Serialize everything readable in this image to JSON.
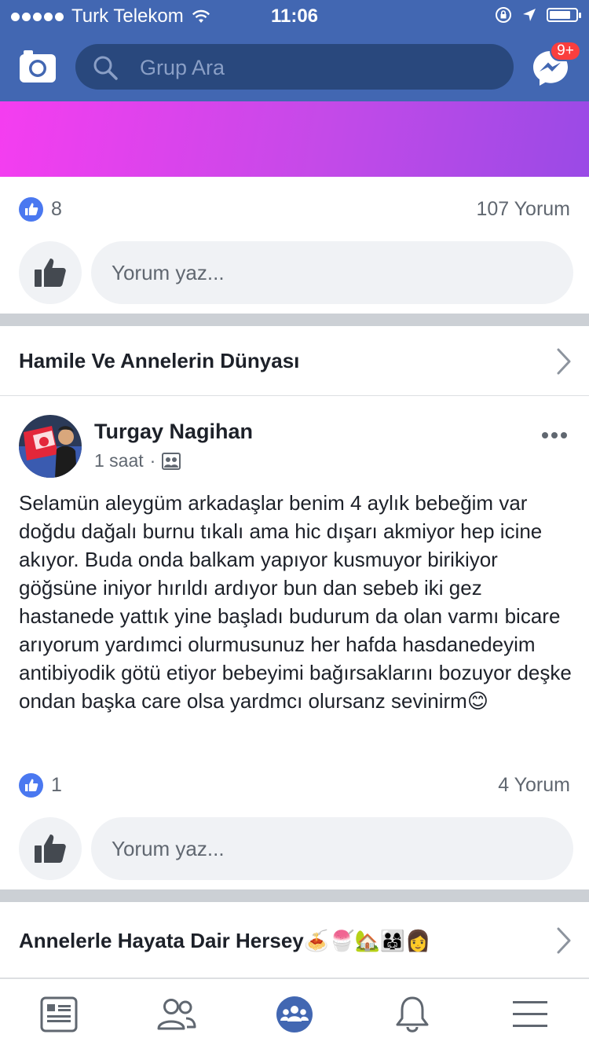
{
  "status_bar": {
    "carrier": "Turk Telekom",
    "time": "11:06",
    "battery_level": 0.8
  },
  "header": {
    "search_placeholder": "Grup Ara",
    "messenger_badge": "9+",
    "icons": {
      "camera": "camera-icon",
      "search": "search-icon",
      "messenger": "messenger-icon"
    }
  },
  "colors": {
    "brand": "#4267b2",
    "search_bg": "#29487d",
    "banner_start": "#f53df0",
    "banner_end": "#9a4ae6",
    "like": "#4a78f0",
    "badge": "#fa3e3e",
    "separator": "#ccd0d5"
  },
  "post1": {
    "like_count": "8",
    "comment_count": "107 Yorum",
    "comment_placeholder": "Yorum yaz..."
  },
  "group1": {
    "title": "Hamile Ve Annelerin Dünyası"
  },
  "post2": {
    "author": "Turgay Nagihan",
    "time": "1 saat",
    "separator": "·",
    "text": "Selamün aleygüm arkadaşlar benim 4 aylık bebeğim var doğdu dağalı burnu tıkalı ama hic dışarı akmiyor hep icine akıyor. Buda onda balkam yapıyor kusmuyor birikiyor göğsüne iniyor hırıldı ardıyor bun dan sebeb iki gez hastanede yattık yine başladı budurum da olan varmı bicare arıyorum yardımci olurmusunuz her hafda hasdanedeyim antibiyodik götü etiyor bebeyimi bağırsaklarını bozuyor deşke ondan başka care olsa yardmcı olursanz sevinirm😊",
    "like_count": "1",
    "comment_count": "4 Yorum",
    "comment_placeholder": "Yorum yaz..."
  },
  "group2": {
    "title": "Annelerle Hayata Dair Hersey🍝🍧🏡👨‍👩‍👧👩"
  },
  "tab_bar": {
    "tabs": [
      "news-feed-icon",
      "friends-icon",
      "groups-icon",
      "notifications-icon",
      "menu-icon"
    ],
    "active": "groups-icon"
  }
}
